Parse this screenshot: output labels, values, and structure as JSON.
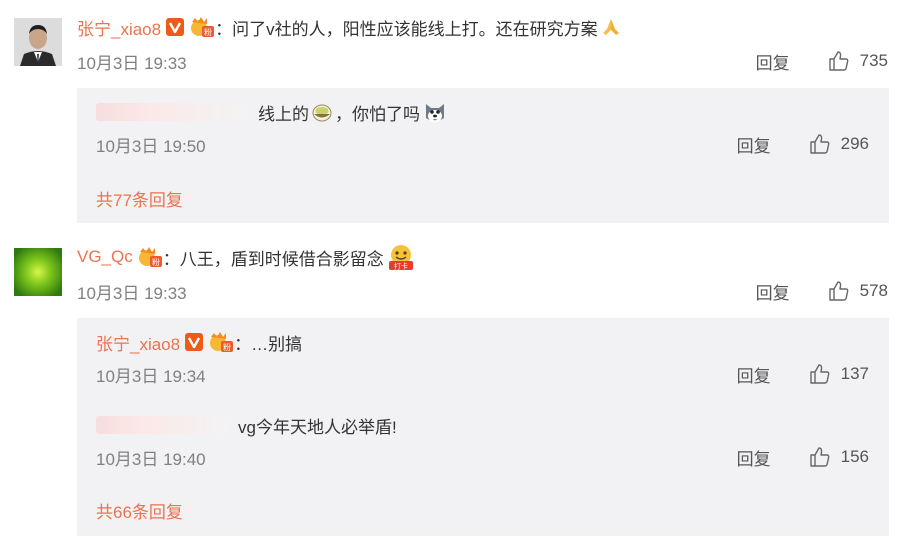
{
  "comments": [
    {
      "user": "张宁_xiao8",
      "colon": "：",
      "text": "问了v社的人，阳性应该能线上打。还在研究方案",
      "time": "10月3日 19:33",
      "reply_label": "回复",
      "likes": "735",
      "icons": [
        "verified-v-icon",
        "fan-badge-icon",
        "pray-emoji"
      ],
      "replies": [
        {
          "user": "",
          "text_before": "线上的",
          "text_after": "，你怕了吗",
          "time": "10月3日 19:50",
          "reply_label": "回复",
          "likes": "296",
          "icons": [
            "bowl-emoji",
            "husky-emoji"
          ]
        }
      ],
      "more_label": "共77条回复"
    },
    {
      "user": "VG_Qc",
      "colon": "：",
      "text": "八王，盾到时候借合影留念",
      "time": "10月3日 19:33",
      "reply_label": "回复",
      "likes": "578",
      "icons": [
        "fan-badge-icon",
        "daka-emoji"
      ],
      "replies": [
        {
          "user": "张宁_xiao8",
          "colon": "：",
          "text": "…别搞",
          "time": "10月3日 19:34",
          "reply_label": "回复",
          "likes": "137"
        },
        {
          "user": "",
          "text": "vg今年天地人必举盾!",
          "time": "10月3日 19:40",
          "reply_label": "回复",
          "likes": "156"
        }
      ],
      "more_label": "共66条回复"
    }
  ],
  "colors": {
    "username": "#eb7350",
    "meta": "#808080",
    "reply_box": "#f2f2f5"
  }
}
